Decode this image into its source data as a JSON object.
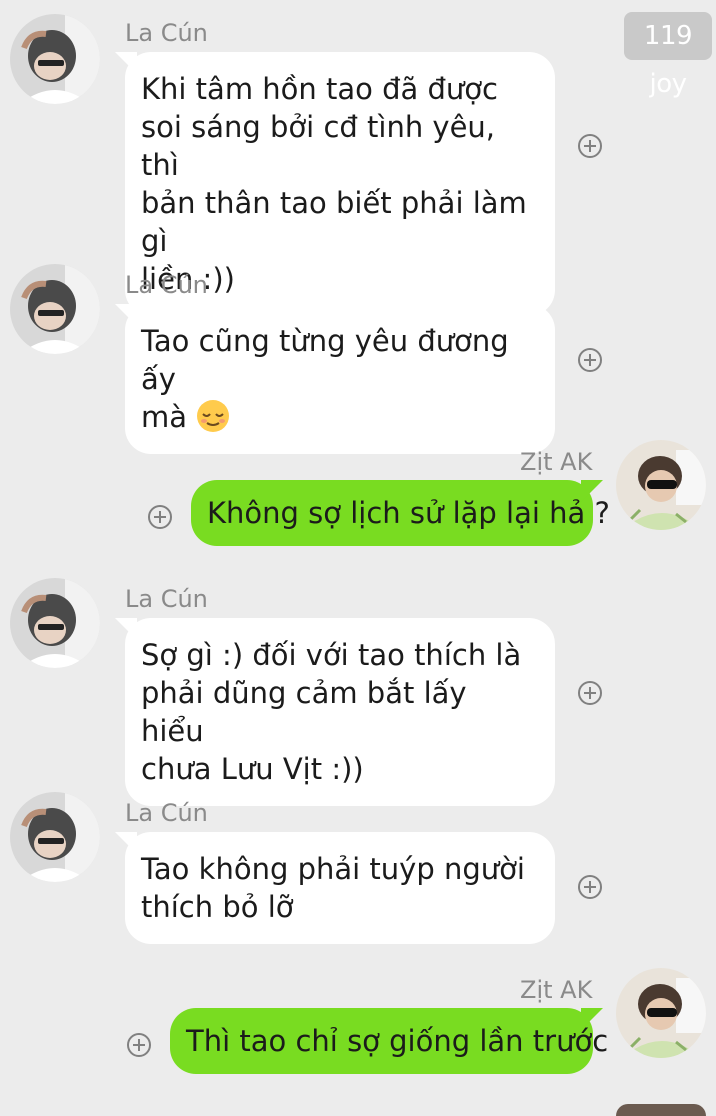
{
  "watermark": "119 joy",
  "contacts": {
    "other": "La Cún",
    "me": "Zịt AK"
  },
  "messages": [
    {
      "from": "other",
      "sender": "La Cún",
      "lines": [
        "Khi tâm hồn tao đã được",
        "soi sáng bởi cđ tình yêu, thì",
        "bản thân tao biết phải làm gì",
        "liền :))"
      ]
    },
    {
      "from": "other",
      "sender": "La Cún",
      "lines": [
        "Tao cũng từng yêu đương ấy",
        "mà"
      ],
      "emoji": "relieved-face"
    },
    {
      "from": "me",
      "sender": "Zịt AK",
      "text": "Không sợ lịch sử lặp lại hả ?"
    },
    {
      "from": "other",
      "sender": "La Cún",
      "lines": [
        "Sợ gì :) đối với tao thích là",
        "phải dũng cảm bắt lấy hiểu",
        "chưa Lưu Vịt :))"
      ]
    },
    {
      "from": "other",
      "sender": "La Cún",
      "lines": [
        "Tao không phải tuýp người",
        "thích bỏ lỡ"
      ]
    },
    {
      "from": "me",
      "sender": "Zịt AK",
      "text": "Thì tao chỉ sợ giống lần trước"
    }
  ],
  "icons": {
    "add": "plus-circle-icon",
    "emoji": "relieved-face-emoji"
  },
  "colors": {
    "background": "#ececec",
    "incoming_bubble": "#ffffff",
    "outgoing_bubble": "#79dc21",
    "name_text": "#8a8a8a"
  }
}
